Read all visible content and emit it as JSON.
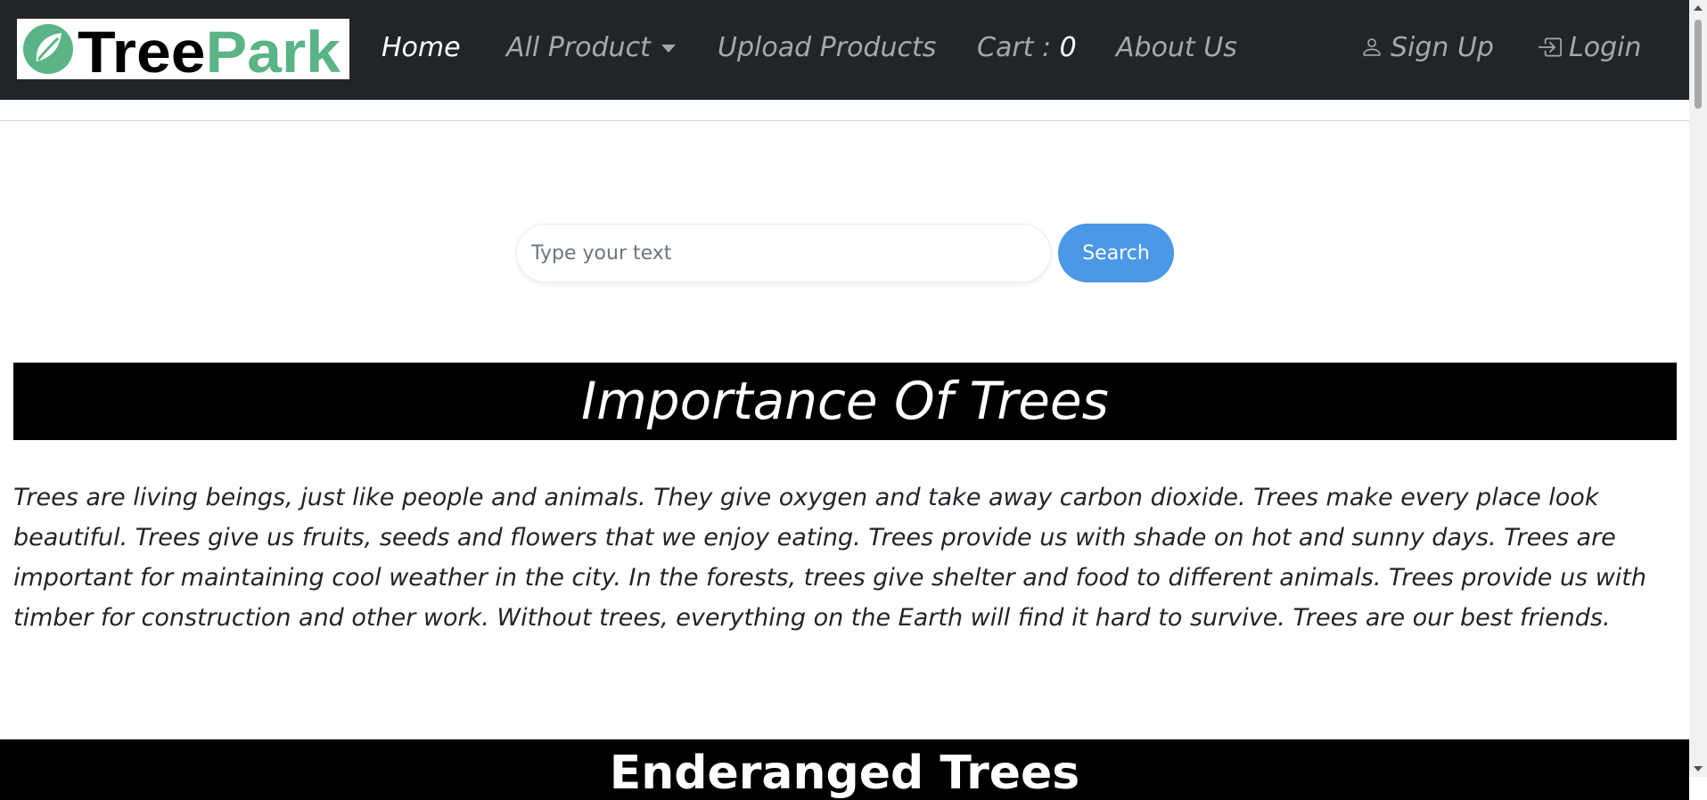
{
  "navbar": {
    "logo": {
      "part1": "Tree",
      "part2": "Park",
      "icon": "leaf-icon"
    },
    "items": [
      {
        "label": "Home",
        "active": true
      },
      {
        "label": "All Product",
        "icon": "caret-down-icon"
      },
      {
        "label": "Upload Products"
      },
      {
        "label": "Cart : ",
        "count": "0"
      },
      {
        "label": "About Us"
      }
    ],
    "signup": {
      "label": "Sign Up",
      "icon": "person-icon"
    },
    "login": {
      "label": "Login",
      "icon": "login-icon"
    }
  },
  "search": {
    "placeholder": "Type your text",
    "button_label": "Search"
  },
  "main": {
    "importance": {
      "title": "Importance Of Trees",
      "text": "Trees are living beings, just like people and animals. They give oxygen and take away carbon dioxide. Trees make every place look beautiful. Trees give us fruits, seeds and flowers that we enjoy eating. Trees provide us with shade on hot and sunny days. Trees are important for maintaining cool weather in the city. In the forests, trees give shelter and food to different animals. Trees provide us with timber for construction and other work. Without trees, everything on the Earth will find it hard to survive. Trees are our best friends."
    },
    "endangered": {
      "title": "Enderanged Trees"
    }
  },
  "colors": {
    "navbar_bg": "#212529",
    "brand_green": "#5ab486",
    "button_blue": "#4a98e6",
    "header_bg": "#000000"
  }
}
